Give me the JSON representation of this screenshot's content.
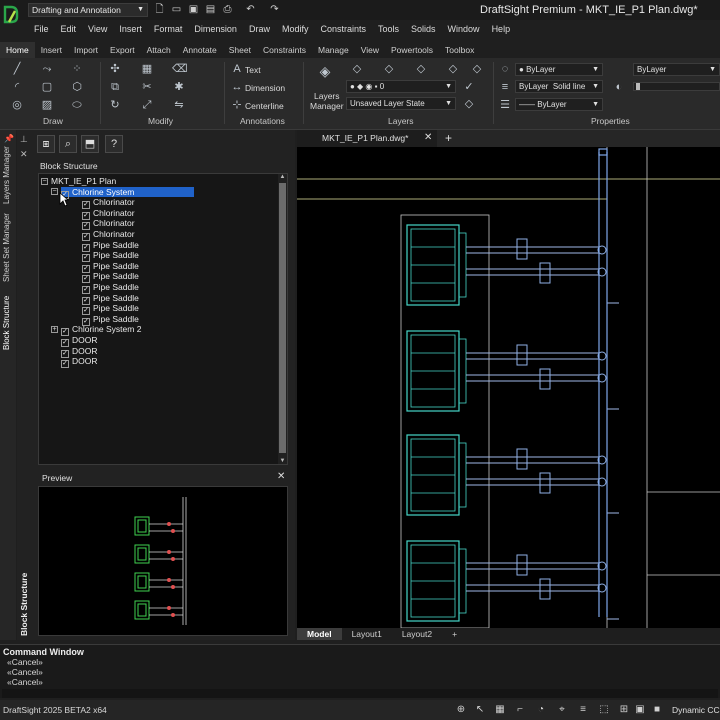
{
  "app": {
    "workspace": "Drafting and Annotation",
    "title": "DraftSight Premium - MKT_IE_P1 Plan.dwg*",
    "accent": "#2062c9"
  },
  "menus": [
    "File",
    "Edit",
    "View",
    "Insert",
    "Format",
    "Dimension",
    "Draw",
    "Modify",
    "Constraints",
    "Tools",
    "Solids",
    "Window",
    "Help"
  ],
  "ribbon_tabs": [
    "Home",
    "Insert",
    "Import",
    "Export",
    "Attach",
    "Annotate",
    "Sheet",
    "Constraints",
    "Manage",
    "View",
    "Powertools",
    "Toolbox"
  ],
  "ribbon": {
    "groups": {
      "draw": "Draw",
      "modify": "Modify",
      "annotations": "Annotations",
      "layers": "Layers",
      "properties": "Properties"
    },
    "annotations": {
      "text": "Text",
      "dimension": "Dimension",
      "centerline": "Centerline"
    },
    "layers": {
      "manager_line1": "Layers",
      "manager_line2": "Manager",
      "layer_value": "0",
      "layer_state": "Unsaved Layer State"
    },
    "properties": {
      "color": "ByLayer",
      "linestyle_layer": "ByLayer",
      "linestyle": "Solid line",
      "lineweight": "ByLayer",
      "right_drop": "ByLayer"
    }
  },
  "side_tabs": [
    "Layers Manager",
    "Sheet Set Manager",
    "Block Structure"
  ],
  "panel": {
    "title": "Block Structure",
    "bottom_label": "Block Structure",
    "tree": [
      {
        "label": "MKT_IE_P1 Plan",
        "level": 0,
        "expander": "-",
        "checkbox": false
      },
      {
        "label": "Chlorine System",
        "level": 1,
        "expander": "-",
        "checkbox": true,
        "selected": true
      },
      {
        "label": "Chlorinator",
        "level": 2,
        "checkbox": true
      },
      {
        "label": "Chlorinator",
        "level": 2,
        "checkbox": true
      },
      {
        "label": "Chlorinator",
        "level": 2,
        "checkbox": true
      },
      {
        "label": "Chlorinator",
        "level": 2,
        "checkbox": true
      },
      {
        "label": "Pipe Saddle",
        "level": 2,
        "checkbox": true
      },
      {
        "label": "Pipe Saddle",
        "level": 2,
        "checkbox": true
      },
      {
        "label": "Pipe Saddle",
        "level": 2,
        "checkbox": true
      },
      {
        "label": "Pipe Saddle",
        "level": 2,
        "checkbox": true
      },
      {
        "label": "Pipe Saddle",
        "level": 2,
        "checkbox": true
      },
      {
        "label": "Pipe Saddle",
        "level": 2,
        "checkbox": true
      },
      {
        "label": "Pipe Saddle",
        "level": 2,
        "checkbox": true
      },
      {
        "label": "Pipe Saddle",
        "level": 2,
        "checkbox": true
      },
      {
        "label": "Chlorine System 2",
        "level": 1,
        "expander": "+",
        "checkbox": true
      },
      {
        "label": "DOOR",
        "level": 1,
        "checkbox": true
      },
      {
        "label": "DOOR",
        "level": 1,
        "checkbox": true
      },
      {
        "label": "DOOR",
        "level": 1,
        "checkbox": true
      }
    ],
    "preview_title": "Preview"
  },
  "document": {
    "tab": "MKT_IE_P1 Plan.dwg*"
  },
  "layout_tabs": [
    "Model",
    "Layout1",
    "Layout2"
  ],
  "command": {
    "title": "Command Window",
    "lines": [
      "«Cancel»",
      "«Cancel»",
      "«Cancel»"
    ]
  },
  "status": {
    "version": "DraftSight 2025 BETA2 x64",
    "ccs": "Dynamic CCS"
  }
}
